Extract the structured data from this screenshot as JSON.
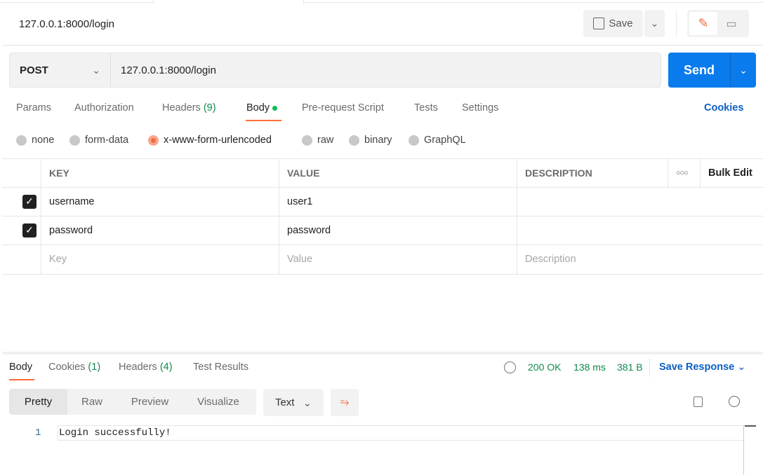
{
  "request": {
    "title": "127.0.0.1:8000/login",
    "method": "POST",
    "url": "127.0.0.1:8000/login",
    "save_label": "Save",
    "send_label": "Send"
  },
  "tabs": [
    {
      "label": "Params"
    },
    {
      "label": "Authorization"
    },
    {
      "label": "Headers",
      "count": "(9)"
    },
    {
      "label": "Body"
    },
    {
      "label": "Pre-request Script"
    },
    {
      "label": "Tests"
    },
    {
      "label": "Settings"
    }
  ],
  "cookies_link": "Cookies",
  "body_types": [
    "none",
    "form-data",
    "x-www-form-urlencoded",
    "raw",
    "binary",
    "GraphQL"
  ],
  "selected_body_type": "x-www-form-urlencoded",
  "table": {
    "headers": [
      "KEY",
      "VALUE",
      "DESCRIPTION"
    ],
    "bulk_edit": "Bulk Edit",
    "rows": [
      {
        "checked": true,
        "key": "username",
        "value": "user1",
        "description": ""
      },
      {
        "checked": true,
        "key": "password",
        "value": "password",
        "description": ""
      }
    ],
    "placeholders": {
      "key": "Key",
      "value": "Value",
      "description": "Description"
    }
  },
  "response": {
    "tabs": [
      {
        "label": "Body"
      },
      {
        "label": "Cookies",
        "count": "(1)"
      },
      {
        "label": "Headers",
        "count": "(4)"
      },
      {
        "label": "Test Results"
      }
    ],
    "status": "200 OK",
    "time": "138 ms",
    "size": "381 B",
    "save_response": "Save Response",
    "views": [
      "Pretty",
      "Raw",
      "Preview",
      "Visualize"
    ],
    "format": "Text",
    "lines": [
      {
        "num": "1",
        "text": "Login successfully!"
      }
    ]
  },
  "colors": {
    "accent": "#ff6c37",
    "send": "#097bed",
    "link": "#0b5fc4",
    "status": "#0f8a4a"
  }
}
